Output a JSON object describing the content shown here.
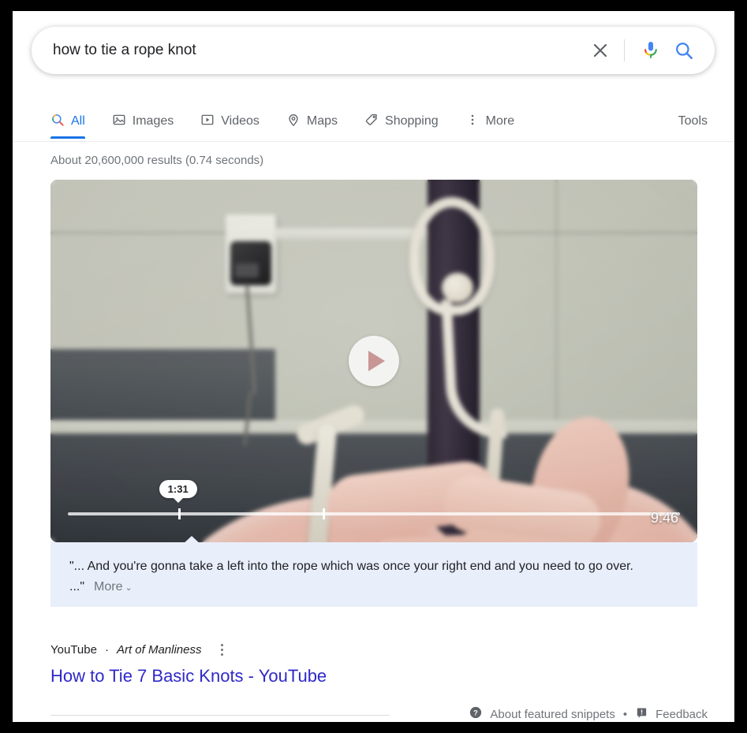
{
  "search": {
    "query": "how to tie a rope knot",
    "placeholder": "Search",
    "clear_icon": "close-icon",
    "mic_icon": "microphone-icon",
    "search_icon": "search-icon"
  },
  "nav": {
    "tabs": [
      {
        "label": "All",
        "icon": "google-search-icon",
        "active": true
      },
      {
        "label": "Images",
        "icon": "image-icon",
        "active": false
      },
      {
        "label": "Videos",
        "icon": "video-icon",
        "active": false
      },
      {
        "label": "Maps",
        "icon": "map-pin-icon",
        "active": false
      },
      {
        "label": "Shopping",
        "icon": "price-tag-icon",
        "active": false
      },
      {
        "label": "More",
        "icon": "more-vertical-icon",
        "active": false
      }
    ],
    "tools_label": "Tools",
    "active_color": "#1a73e8",
    "inactive_color": "#5f6368"
  },
  "results": {
    "count_text": "About 20,600,000 results (0.74 seconds)"
  },
  "video": {
    "play_icon": "play-icon",
    "current_time": "1:31",
    "duration": "9:46",
    "progress_percent": 18,
    "segment_start_percent": 18,
    "segment_end_percent": 42
  },
  "snippet": {
    "quote": "\"... And you're gonna take a left into the rope which was once your right end and you need to go over. ...\"",
    "more_label": "More",
    "more_chevron": "chevron-down-icon",
    "background_color": "#e9eefb"
  },
  "result": {
    "source": "YouTube",
    "separator": "·",
    "channel": "Art of Manliness",
    "menu_icon": "kebab-menu-icon",
    "title": "How to Tie 7 Basic Knots - YouTube",
    "title_color": "#2f28c9"
  },
  "footer": {
    "help_icon": "help-circle-icon",
    "about_label": "About featured snippets",
    "dot": "•",
    "feedback_icon": "feedback-flag-icon",
    "feedback_label": "Feedback"
  }
}
